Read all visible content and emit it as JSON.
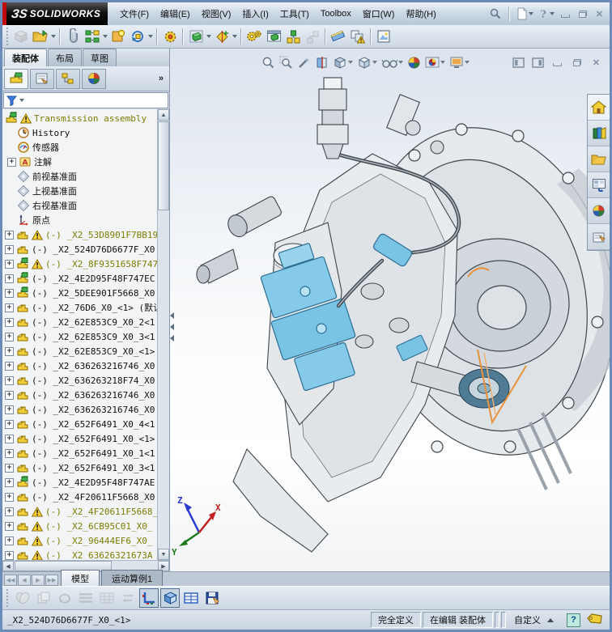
{
  "window": {
    "brand_glyph": "ЗS",
    "brand_name": "SOLIDWORKS"
  },
  "menubar": {
    "items": [
      {
        "key": "file",
        "label": "文件(F)"
      },
      {
        "key": "edit",
        "label": "编辑(E)"
      },
      {
        "key": "view",
        "label": "视图(V)"
      },
      {
        "key": "insert",
        "label": "插入(I)"
      },
      {
        "key": "tools",
        "label": "工具(T)"
      },
      {
        "key": "toolbox",
        "label": "Toolbox"
      },
      {
        "key": "window",
        "label": "窗口(W)"
      },
      {
        "key": "help",
        "label": "帮助(H)"
      }
    ]
  },
  "command_tabs": {
    "active": 0,
    "items": [
      {
        "key": "assembly",
        "label": "装配体"
      },
      {
        "key": "layout",
        "label": "布局"
      },
      {
        "key": "sketch",
        "label": "草图"
      }
    ]
  },
  "panel": {
    "overflow_chevron": "»"
  },
  "tree": {
    "root": {
      "label": "Transmission assembly",
      "warn": true
    },
    "folders": [
      {
        "icon": "history",
        "label": "History"
      },
      {
        "icon": "sensors",
        "label": "传感器"
      },
      {
        "icon": "annotations",
        "label": "注解",
        "expand": true
      },
      {
        "icon": "plane",
        "label": "前视基准面"
      },
      {
        "icon": "plane",
        "label": "上视基准面"
      },
      {
        "icon": "plane",
        "label": "右视基准面"
      },
      {
        "icon": "origin",
        "label": "原点"
      }
    ],
    "comp_prefix": "(-)",
    "components": [
      {
        "type": "part",
        "warn": true,
        "label": "_X2_53D8901F7BB19"
      },
      {
        "type": "part",
        "warn": false,
        "label": "_X2_524D76D6677F_X0"
      },
      {
        "type": "assembly",
        "warn": true,
        "label": "_X2_8F9351658F747"
      },
      {
        "type": "assembly",
        "warn": false,
        "label": "_X2_4E2D95F48F747EC"
      },
      {
        "type": "assembly",
        "warn": false,
        "label": "_X2_5DEE901F5668_X0"
      },
      {
        "type": "part",
        "warn": false,
        "label": "_X2_76D6_X0_<1> (默认"
      },
      {
        "type": "part",
        "warn": false,
        "label": "_X2_62E853C9_X0_2<1"
      },
      {
        "type": "part",
        "warn": false,
        "label": "_X2_62E853C9_X0_3<1"
      },
      {
        "type": "part",
        "warn": false,
        "label": "_X2_62E853C9_X0_<1>"
      },
      {
        "type": "part",
        "warn": false,
        "label": "_X2_636263216746_X0"
      },
      {
        "type": "part",
        "warn": false,
        "label": "_X2_636263218F74_X0"
      },
      {
        "type": "part",
        "warn": false,
        "label": "_X2_636263216746_X0"
      },
      {
        "type": "part",
        "warn": false,
        "label": "_X2_636263216746_X0"
      },
      {
        "type": "part",
        "warn": false,
        "label": "_X2_652F6491_X0_4<1"
      },
      {
        "type": "part",
        "warn": false,
        "label": "_X2_652F6491_X0_<1>"
      },
      {
        "type": "part",
        "warn": false,
        "label": "_X2_652F6491_X0_1<1"
      },
      {
        "type": "part",
        "warn": false,
        "label": "_X2_652F6491_X0_3<1"
      },
      {
        "type": "assembly",
        "warn": false,
        "label": "_X2_4E2D95F48F747AE"
      },
      {
        "type": "part",
        "warn": false,
        "label": "_X2_4F20611F5668_X0"
      },
      {
        "type": "part",
        "warn": true,
        "label": "_X2_4F20611F5668_"
      },
      {
        "type": "part",
        "warn": true,
        "label": "_X2_6CB95C01_X0_"
      },
      {
        "type": "part",
        "warn": true,
        "label": "_X2_96444EF6_X0_"
      },
      {
        "type": "part",
        "warn": true,
        "label": "_X2_63626321673A"
      }
    ]
  },
  "triad": {
    "x": "X",
    "y": "Y",
    "z": "Z"
  },
  "model_tabs": {
    "items": [
      {
        "key": "model",
        "label": "模型",
        "active": true
      },
      {
        "key": "motion-study-1",
        "label": "运动算例1",
        "active": false
      }
    ]
  },
  "statusbar": {
    "selected": "_X2_524D76D6677F_X0_<1>",
    "fully_defined": "完全定义",
    "editing": "在编辑 装配体",
    "custom": "自定义",
    "help_glyph": "?"
  },
  "colors": {
    "highlight_cyan": "#7ec6e6",
    "highlight_orange": "#e8923a",
    "warn_olive": "#7d7d00",
    "chrome_blue": "#6b8cb8"
  }
}
